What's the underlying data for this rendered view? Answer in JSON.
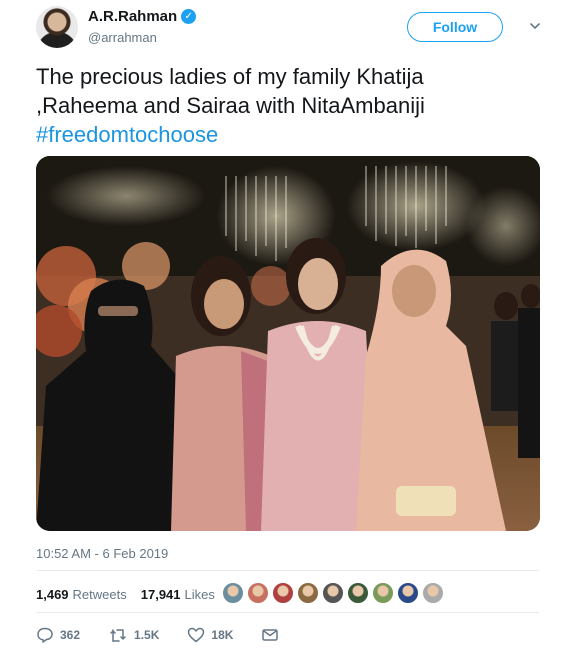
{
  "author": {
    "display_name": "A.R.Rahman",
    "handle": "@arrahman",
    "verified_icon": "verified-badge-icon"
  },
  "follow_label": "Follow",
  "tweet": {
    "text_line1": "The precious ladies of my family Khatija",
    "text_line2": ",Raheema and Sairaa with NitaAmbaniji",
    "hashtag": "#freedomtochoose",
    "timestamp": "10:52 AM - 6 Feb 2019"
  },
  "stats": {
    "retweets_count": "1,469",
    "retweets_label": "Retweets",
    "likes_count": "17,941",
    "likes_label": "Likes"
  },
  "liker_avatars": [
    "#6b8e9e",
    "#c87060",
    "#b04040",
    "#8a6a40",
    "#555555",
    "#3a5a3a",
    "#7a9a5a",
    "#2a4a8a",
    "#aaaaaa"
  ],
  "actions": {
    "reply_count": "362",
    "retweet_count": "1.5K",
    "like_count": "18K"
  },
  "colors": {
    "accent": "#1da1f2",
    "hashtag": "#1b95e0",
    "muted": "#657786"
  }
}
